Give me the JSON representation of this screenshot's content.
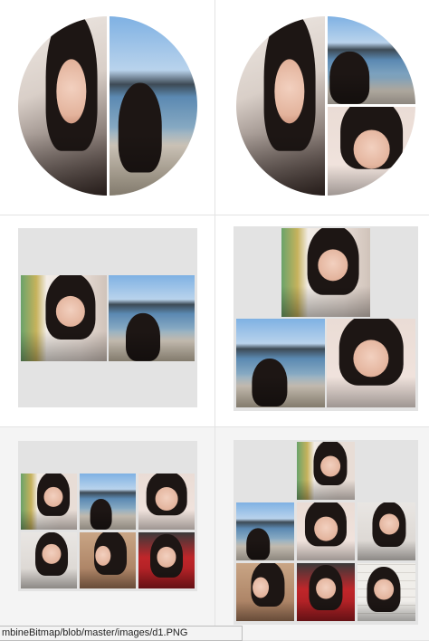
{
  "status_url": "mbineBitmap/blob/master/images/d1.PNG",
  "layouts": [
    {
      "name": "circle-two",
      "photos": [
        "portrait-girl",
        "beach-girl"
      ]
    },
    {
      "name": "circle-three",
      "photos": [
        "portrait-girl",
        "beach-girl",
        "wink-girl"
      ]
    },
    {
      "name": "square-two",
      "photos": [
        "portrait-girl",
        "beach-girl"
      ]
    },
    {
      "name": "square-three",
      "photos": [
        "portrait-girl",
        "beach-girl",
        "wink-girl"
      ]
    },
    {
      "name": "square-six",
      "photos": [
        "portrait-girl",
        "beach-girl",
        "wink-girl",
        "sweater-girl",
        "hair-girl",
        "hood-girl"
      ]
    },
    {
      "name": "square-eight",
      "photos": [
        "portrait-girl",
        "beach-girl",
        "wink-girl",
        "sweater-girl",
        "hair-girl",
        "hood-girl",
        "bar-girl",
        "stripe-girl"
      ]
    }
  ],
  "colors": {
    "divider": "#e3e3e3",
    "panel_gray": "#e3e3e3",
    "sky": "#6fa6dc",
    "sea": "#5b89b2",
    "sand": "#d8cfc2",
    "hair": "#1d1614",
    "skin": "#e8bba5"
  }
}
